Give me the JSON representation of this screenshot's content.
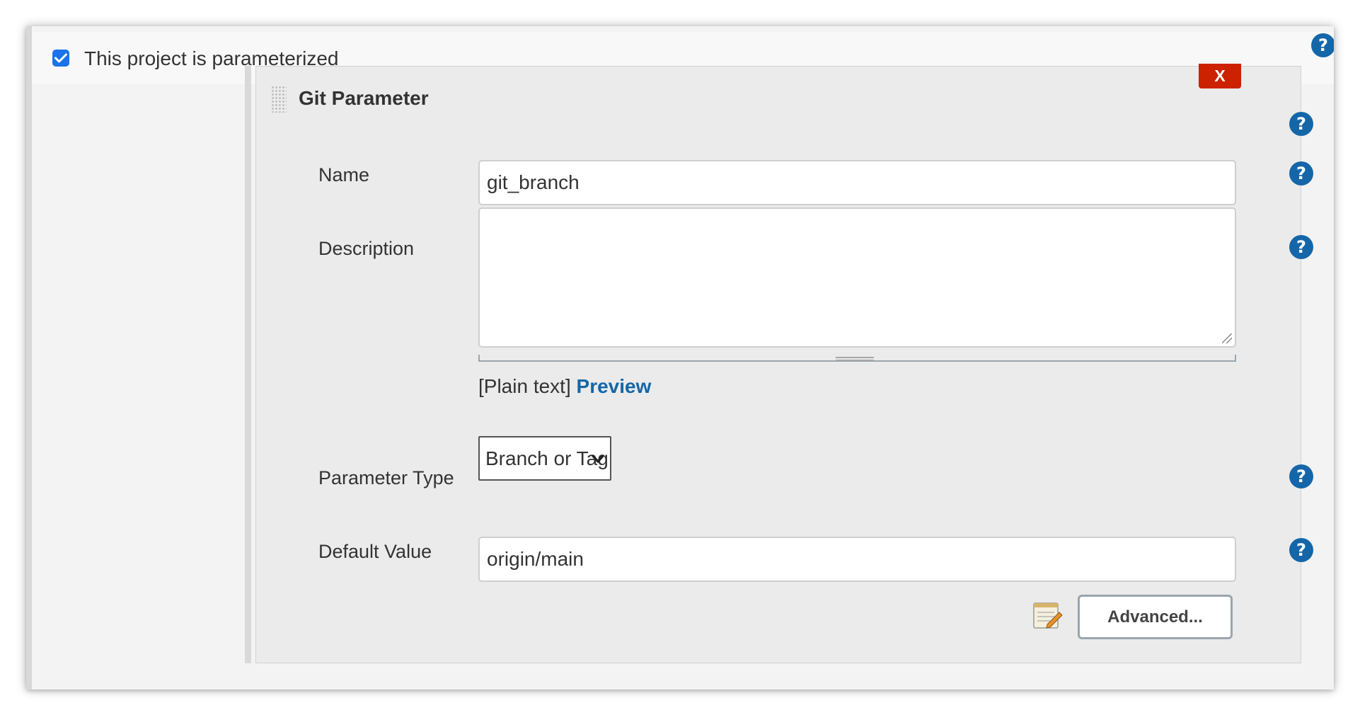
{
  "header": {
    "checkbox_checked": true,
    "label": "This project is parameterized"
  },
  "parameter": {
    "title": "Git Parameter",
    "close_label": "X",
    "fields": {
      "name_label": "Name",
      "name_value": "git_branch",
      "description_label": "Description",
      "description_value": "",
      "format_text": "[Plain text]",
      "preview_label": "Preview",
      "type_label": "Parameter Type",
      "type_value": "Branch or Tag",
      "default_label": "Default Value",
      "default_value": "origin/main"
    },
    "advanced_label": "Advanced..."
  },
  "help_icon_text": "?",
  "colors": {
    "accent": "#1566a8",
    "checkbox": "#1a73e8",
    "close_button": "#cc2200",
    "panel_background": "#ebebeb"
  },
  "icons": [
    "check-icon",
    "help-icon",
    "drag-handle-icon",
    "resize-grip-icon",
    "chevron-down-icon",
    "notepad-icon"
  ]
}
